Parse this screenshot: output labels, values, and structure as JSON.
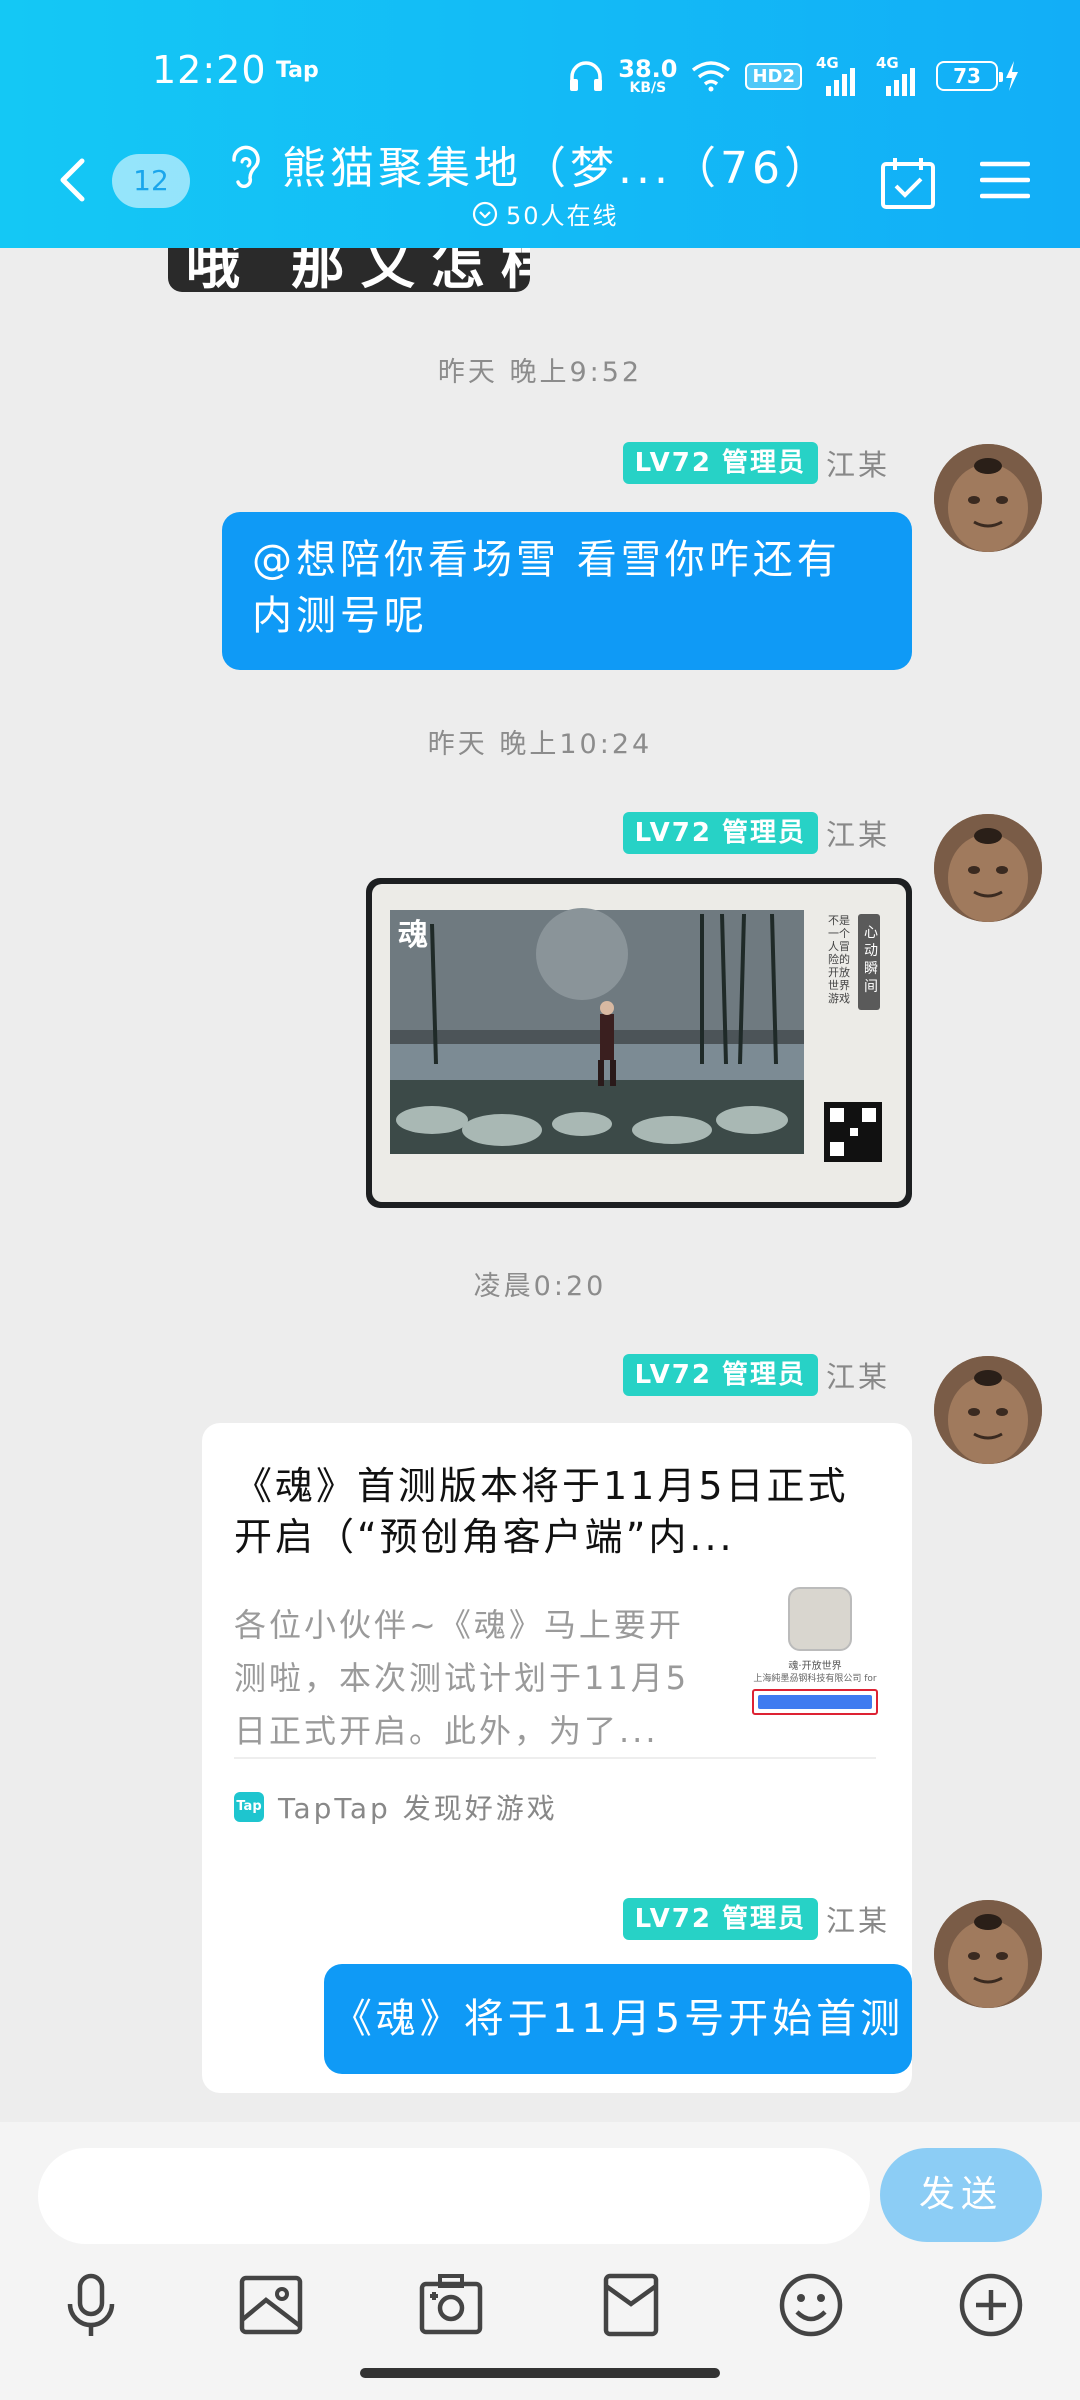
{
  "status_bar": {
    "time": "12:20",
    "tap_label": "Tap",
    "speed_value": "38.0",
    "speed_unit": "KB/S",
    "hd_label": "HD2",
    "net1_label": "4G",
    "net2_label": "4G",
    "battery": "73"
  },
  "header": {
    "unread_count": "12",
    "title": "熊猫聚集地（梦...（76）",
    "online_text": "50人在线"
  },
  "messages": {
    "prev_sticker_text": "哦 那又怎样",
    "time1": "昨天 晚上9:52",
    "time2": "昨天 晚上10:24",
    "time3": "凌晨0:20",
    "sender_level": "LV72",
    "sender_role": "管理员",
    "sender_name": "江某",
    "msg1_line1": "@想陪你看场雪 看雪你咋还有",
    "msg1_line2": "内测号呢",
    "image_caption_vertical": "心动瞬间",
    "image_side_text": "不是一个人冒险的开放世界游戏",
    "image_logo_text": "魂",
    "card_title": "《魂》首测版本将于11月5日正式开启（“预创角客户端”内...",
    "card_desc": "各位小伙伴~《魂》马上要开测啦，本次测试计划于11月5日正式开启。此外，为了...",
    "card_thumb_line1": "魂·开放世界",
    "card_thumb_line2": "上海純墨刕钢科技有限公司 for",
    "card_source_logo": "Tap",
    "card_source": "TapTap 发现好游戏",
    "msg4": "《魂》将于11月5号开始首测"
  },
  "input": {
    "placeholder": "",
    "send_label": "发送"
  },
  "colors": {
    "header_start": "#14c8f5",
    "header_end": "#12aef7",
    "bubble": "#0f9af6",
    "badge": "#27d2c6",
    "send_disabled": "#8ccdf5"
  }
}
